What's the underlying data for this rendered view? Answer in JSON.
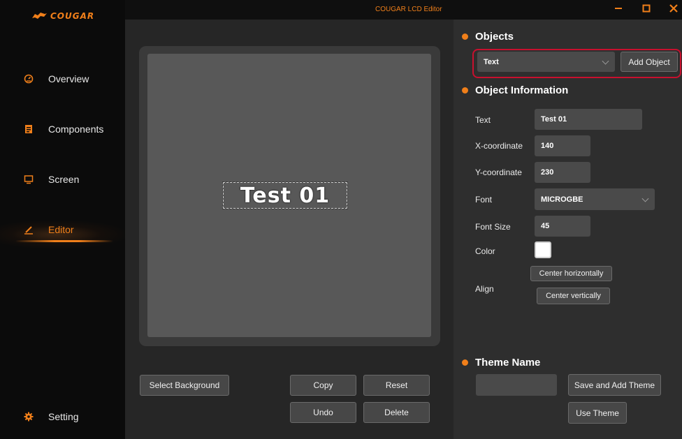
{
  "app": {
    "logo_text": "COUGAR",
    "window_title": "COUGAR LCD Editor"
  },
  "colors": {
    "accent": "#f07f1a",
    "highlight": "#c8102e"
  },
  "sidebar": {
    "items": [
      {
        "label": "Overview",
        "icon": "speedometer-icon"
      },
      {
        "label": "Components",
        "icon": "components-icon"
      },
      {
        "label": "Screen",
        "icon": "monitor-icon"
      },
      {
        "label": "Editor",
        "icon": "pencil-icon",
        "active": true
      },
      {
        "label": "Setting",
        "icon": "gear-icon"
      }
    ]
  },
  "canvas": {
    "text": "Test 01"
  },
  "canvas_buttons": {
    "select_background": "Select Background",
    "copy": "Copy",
    "reset": "Reset",
    "undo": "Undo",
    "delete": "Delete"
  },
  "objects": {
    "title": "Objects",
    "selected_type": "Text",
    "add_object": "Add Object"
  },
  "object_info": {
    "title": "Object Information",
    "text_label": "Text",
    "text_value": "Test 01",
    "x_label": "X-coordinate",
    "x_value": "140",
    "y_label": "Y-coordinate",
    "y_value": "230",
    "font_label": "Font",
    "font_value": "MICROGBE",
    "font_size_label": "Font Size",
    "font_size_value": "45",
    "color_label": "Color",
    "color_value": "#ffffff",
    "align_label": "Align",
    "center_h": "Center horizontally",
    "center_v": "Center vertically"
  },
  "theme": {
    "title": "Theme Name",
    "name_value": "",
    "save_add": "Save and Add Theme",
    "use": "Use Theme"
  }
}
